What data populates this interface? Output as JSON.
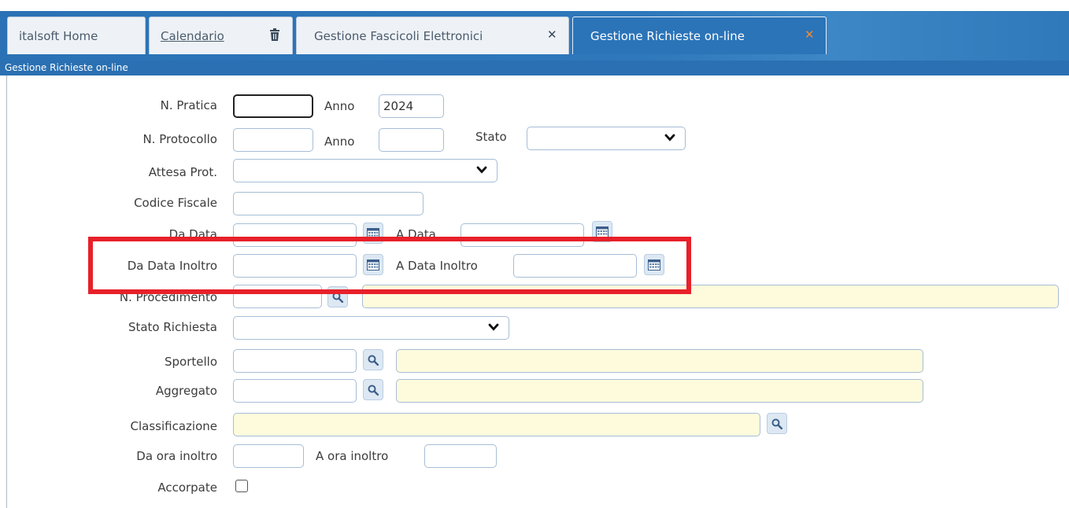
{
  "tabs": [
    {
      "label": "italsoft Home"
    },
    {
      "label": "Calendario",
      "icon": "trash-icon"
    },
    {
      "label": "Gestione Fascicoli Elettronici",
      "icon": "close-icon"
    },
    {
      "label": "Gestione Richieste on-line",
      "icon": "close-icon",
      "active": true
    }
  ],
  "subtitle": "Gestione Richieste on-line",
  "form": {
    "n_pratica": {
      "label": "N. Pratica",
      "value": ""
    },
    "anno_pratica": {
      "label": "Anno",
      "value": "2024"
    },
    "n_protocollo": {
      "label": "N. Protocollo",
      "value": ""
    },
    "anno_protocollo": {
      "label": "Anno",
      "value": ""
    },
    "stato": {
      "label": "Stato",
      "value": ""
    },
    "attesa_prot": {
      "label": "Attesa Prot.",
      "value": ""
    },
    "codice_fiscale": {
      "label": "Codice Fiscale",
      "value": ""
    },
    "da_data": {
      "label": "Da Data",
      "value": ""
    },
    "a_data": {
      "label": "A Data",
      "value": ""
    },
    "da_data_inoltro": {
      "label": "Da Data Inoltro",
      "value": ""
    },
    "a_data_inoltro": {
      "label": "A Data Inoltro",
      "value": ""
    },
    "n_procedimento": {
      "label": "N. Procedimento",
      "value": ""
    },
    "stato_richiesta": {
      "label": "Stato Richiesta",
      "value": ""
    },
    "sportello": {
      "label": "Sportello",
      "value": ""
    },
    "aggregato": {
      "label": "Aggregato",
      "value": ""
    },
    "classificazione": {
      "label": "Classificazione",
      "value": ""
    },
    "da_ora_inoltro": {
      "label": "Da ora inoltro",
      "value": ""
    },
    "a_ora_inoltro": {
      "label": "A ora inoltro",
      "value": ""
    },
    "accorpate": {
      "label": "Accorpate",
      "checked": false
    }
  },
  "colors": {
    "tab_active": "#2b74b8",
    "highlight": "#e8202a",
    "lookup_field": "#fdfbdc"
  }
}
